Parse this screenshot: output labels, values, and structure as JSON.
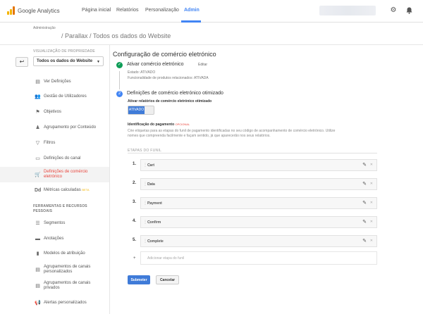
{
  "topnav": {
    "brand": "Google Analytics",
    "tabs": [
      "Página inicial",
      "Relatórios",
      "Personalização",
      "Admin"
    ],
    "active_tab": "Admin"
  },
  "breadcrumb": {
    "section": "Administração",
    "path": "/ Parallax / Todos os dados do Website"
  },
  "view": {
    "label": "VISUALIZAÇÃO DE PROPRIEDADE",
    "selected": "Todos os dados do Website"
  },
  "sidebar": {
    "items": [
      {
        "label": "Ver Definições",
        "icon": "document-icon"
      },
      {
        "label": "Gestão de Utilizadores",
        "icon": "users-icon"
      },
      {
        "label": "Objetivos",
        "icon": "flag-icon"
      },
      {
        "label": "Agrupamento por Conteúdo",
        "icon": "person-icon"
      },
      {
        "label": "Filtros",
        "icon": "filter-icon"
      },
      {
        "label": "Definições do canal",
        "icon": "channel-icon"
      },
      {
        "label": "Definições de comércio eletrónico",
        "icon": "cart-icon",
        "active": true
      },
      {
        "label": "Métricas calculadas",
        "icon": "dd-icon",
        "badge": "BETA"
      }
    ],
    "section_heading": "FERRAMENTAS E RECURSOS PESSOAIS",
    "tools": [
      {
        "label": "Segmentos",
        "icon": "segments-icon"
      },
      {
        "label": "Anotações",
        "icon": "annotation-icon"
      },
      {
        "label": "Modelos de atribuição",
        "icon": "bars-icon"
      },
      {
        "label": "Agrupamentos de canais personalizados",
        "icon": "channels-group-icon"
      },
      {
        "label": "Agrupamentos de canais privados",
        "icon": "private-channels-icon"
      },
      {
        "label": "Alertas personalizados",
        "icon": "megaphone-icon"
      }
    ]
  },
  "main": {
    "title": "Configuração de comércio eletrónico",
    "step1": {
      "title": "Ativar comércio eletrónico",
      "edit": "Editar",
      "status": "Estado: ATIVADO",
      "related": "Funcionalidade de produtos relacionados: ATIVADA"
    },
    "step2": {
      "number": "2",
      "title": "Definições de comércio eletrónico otimizado",
      "enable_label": "Ativar relatórios de comércio eletrónico otimizado",
      "toggle": "ATIVADO",
      "checkout_label": "Identificação do pagamento",
      "optional": "OPCIONAL",
      "description": "Crie etiquetas para as etapas do funil de pagamento identificadas no seu código de acompanhamento de comércio eletrónico. Utilize nomes que compreenda facilmente e façam sentido, já que aparecerão nos seus relatórios.",
      "funnel_label": "ETAPAS DO FUNIL",
      "funnel_steps": [
        {
          "num": "1.",
          "name": "Cart"
        },
        {
          "num": "2.",
          "name": "Data"
        },
        {
          "num": "3.",
          "name": "Payment"
        },
        {
          "num": "4.",
          "name": "Confirm"
        },
        {
          "num": "5.",
          "name": "Complete"
        }
      ],
      "add_plus": "+",
      "add_placeholder": "Adicionar etapa do funil"
    },
    "submit": "Submeter",
    "cancel": "Cancelar"
  },
  "colors": {
    "accent": "#4285f4",
    "success": "#0f9d58",
    "active_item": "#e8453c",
    "primary_button": "#3f7bd8"
  }
}
